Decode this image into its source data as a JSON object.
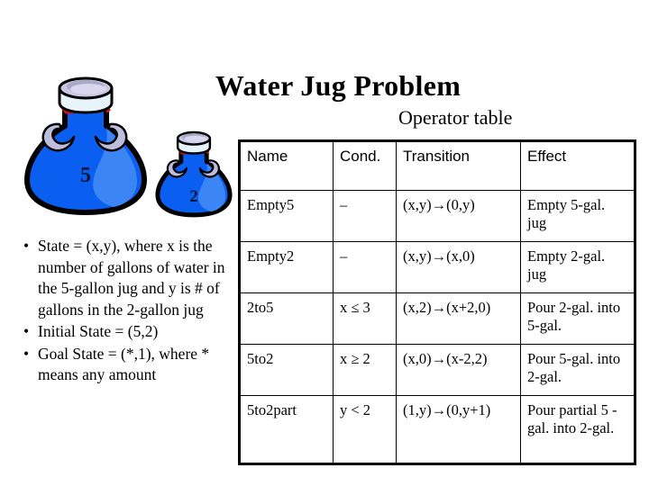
{
  "slide": {
    "title": "Water Jug Problem",
    "subtitle": "Operator table"
  },
  "jugs": [
    {
      "name": "five-gallon-jug",
      "label": "5",
      "capacity": 5
    },
    {
      "name": "two-gallon-jug",
      "label": "2",
      "capacity": 2
    }
  ],
  "bullets": [
    {
      "marker": "•",
      "text": "State = (x,y), where x is the number of gallons of water in the 5-gallon jug and y is # of gallons in the 2-gallon jug"
    },
    {
      "marker": "•",
      "text": "Initial State = (5,2)"
    },
    {
      "marker": "•",
      "text": "Goal State = (*,1), where * means any amount"
    }
  ],
  "operator_table": {
    "headers": [
      "Name",
      "Cond.",
      "Transition",
      "Effect"
    ],
    "rows": [
      {
        "name": "Empty5",
        "cond": "–",
        "transition": "(x,y)→(0,y)",
        "effect": "Empty 5-gal. jug"
      },
      {
        "name": "Empty2",
        "cond": "–",
        "transition": "(x,y)→(x,0)",
        "effect": "Empty 2-gal. jug"
      },
      {
        "name": "2to5",
        "cond": "x ≤ 3",
        "transition": "(x,2)→(x+2,0)",
        "effect": "Pour 2-gal. into 5-gal."
      },
      {
        "name": "5to2",
        "cond": "x ≥ 2",
        "transition": "(x,0)→(x-2,2)",
        "effect": "Pour 5-gal. into 2-gal."
      },
      {
        "name": "5to2part",
        "cond": "y < 2",
        "transition": "(1,y)→(0,y+1)",
        "effect": "Pour partial 5 -gal. into 2-gal."
      }
    ]
  },
  "colors": {
    "jug_body": "#0b5ff0",
    "jug_highlight": "#3c85f5",
    "jug_outline": "#000000",
    "jug_rim_light": "#e8f4fb",
    "jug_rim_shadow": "#a9a9c6",
    "jug_rim_top": "#c9c7e4",
    "jug_handle": "#bdbedc",
    "jug_band_red": "#cc1122",
    "table_border": "#000000",
    "background": "#ffffff",
    "text": "#000000"
  }
}
